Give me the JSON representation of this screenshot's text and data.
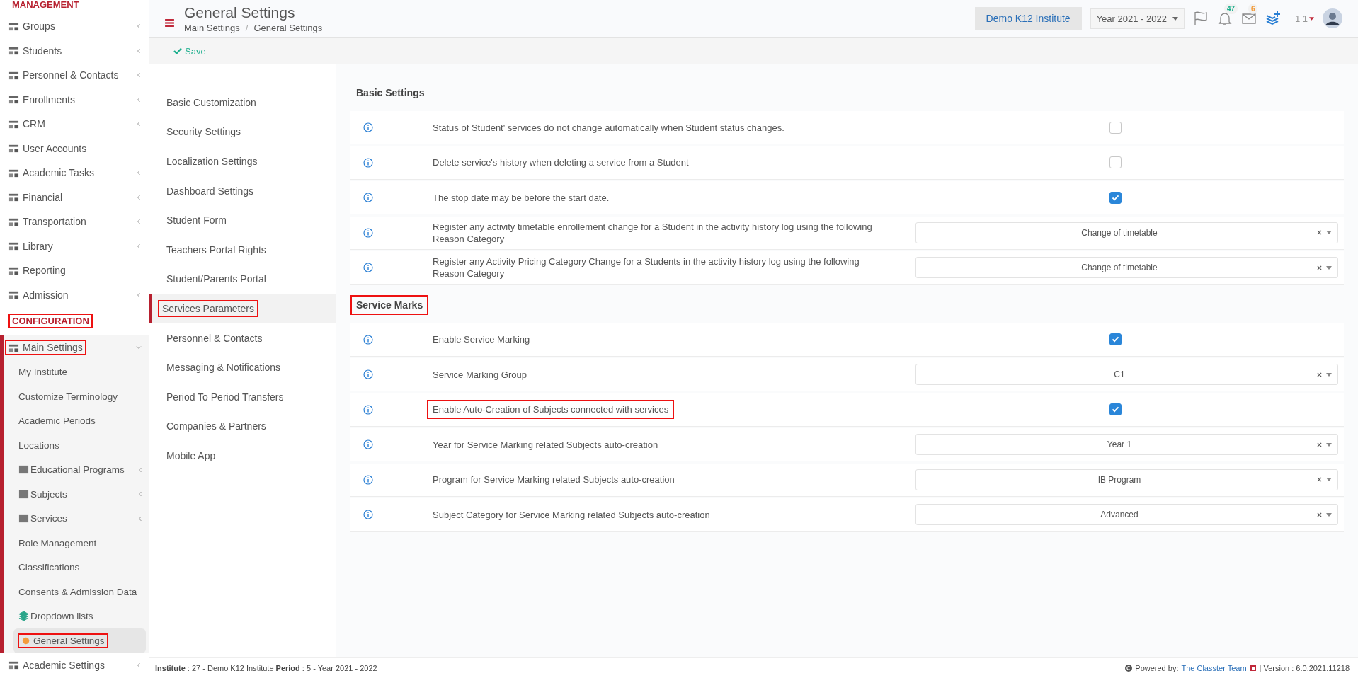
{
  "sidebar": {
    "sections": [
      {
        "title": "MANAGEMENT",
        "highlighted": false,
        "items": [
          {
            "label": "Groups",
            "has_children": true,
            "expanded": false,
            "highlighted": false
          },
          {
            "label": "Students",
            "has_children": true,
            "expanded": false,
            "highlighted": false
          },
          {
            "label": "Personnel & Contacts",
            "has_children": true,
            "expanded": false,
            "highlighted": false
          },
          {
            "label": "Enrollments",
            "has_children": true,
            "expanded": false,
            "highlighted": false
          },
          {
            "label": "CRM",
            "has_children": true,
            "expanded": false,
            "highlighted": false
          },
          {
            "label": "User Accounts",
            "has_children": false,
            "expanded": false,
            "highlighted": false
          },
          {
            "label": "Academic Tasks",
            "has_children": true,
            "expanded": false,
            "highlighted": false
          },
          {
            "label": "Financial",
            "has_children": true,
            "expanded": false,
            "highlighted": false
          },
          {
            "label": "Transportation",
            "has_children": true,
            "expanded": false,
            "highlighted": false
          },
          {
            "label": "Library",
            "has_children": true,
            "expanded": false,
            "highlighted": false
          },
          {
            "label": "Reporting",
            "has_children": false,
            "expanded": false,
            "highlighted": false
          },
          {
            "label": "Admission",
            "has_children": true,
            "expanded": false,
            "highlighted": false
          }
        ]
      },
      {
        "title": "CONFIGURATION",
        "highlighted": true,
        "items": [
          {
            "label": "Main Settings",
            "has_children": true,
            "expanded": true,
            "highlighted": true,
            "children": [
              {
                "label": "My Institute",
                "has_children": false,
                "selected": false,
                "highlighted": false
              },
              {
                "label": "Customize Terminology",
                "has_children": false,
                "selected": false,
                "highlighted": false
              },
              {
                "label": "Academic Periods",
                "has_children": false,
                "selected": false,
                "highlighted": false
              },
              {
                "label": "Locations",
                "has_children": false,
                "selected": false,
                "highlighted": false
              },
              {
                "label": "Educational Programs",
                "has_children": true,
                "selected": false,
                "highlighted": false
              },
              {
                "label": "Subjects",
                "has_children": true,
                "selected": false,
                "highlighted": false
              },
              {
                "label": "Services",
                "has_children": true,
                "selected": false,
                "highlighted": false
              },
              {
                "label": "Role Management",
                "has_children": false,
                "selected": false,
                "highlighted": false
              },
              {
                "label": "Classifications",
                "has_children": false,
                "selected": false,
                "highlighted": false
              },
              {
                "label": "Consents & Admission Data",
                "has_children": false,
                "selected": false,
                "highlighted": false
              },
              {
                "label": "Dropdown lists",
                "has_children": false,
                "selected": false,
                "highlighted": false
              },
              {
                "label": "General Settings",
                "has_children": false,
                "selected": true,
                "highlighted": true
              }
            ]
          },
          {
            "label": "Academic Settings",
            "has_children": true,
            "expanded": false,
            "highlighted": false
          }
        ]
      }
    ]
  },
  "header": {
    "title": "General Settings",
    "breadcrumbs": [
      "Main Settings",
      "General Settings"
    ],
    "breadcrumb_separator": "/",
    "institute": "Demo K12 Institute",
    "year": "Year 2021 - 2022",
    "notifications": "47",
    "messages": "6",
    "user": "1 1"
  },
  "toolbar": {
    "save": "Save"
  },
  "tabs": [
    {
      "label": "Basic Customization",
      "selected": false,
      "highlighted": false
    },
    {
      "label": "Security Settings",
      "selected": false,
      "highlighted": false
    },
    {
      "label": "Localization Settings",
      "selected": false,
      "highlighted": false
    },
    {
      "label": "Dashboard Settings",
      "selected": false,
      "highlighted": false
    },
    {
      "label": "Student Form",
      "selected": false,
      "highlighted": false
    },
    {
      "label": "Teachers Portal Rights",
      "selected": false,
      "highlighted": false
    },
    {
      "label": "Student/Parents Portal",
      "selected": false,
      "highlighted": false
    },
    {
      "label": "Services Parameters",
      "selected": true,
      "highlighted": true
    },
    {
      "label": "Personnel & Contacts",
      "selected": false,
      "highlighted": false
    },
    {
      "label": "Messaging & Notifications",
      "selected": false,
      "highlighted": false
    },
    {
      "label": "Period To Period Transfers",
      "selected": false,
      "highlighted": false
    },
    {
      "label": "Companies & Partners",
      "selected": false,
      "highlighted": false
    },
    {
      "label": "Mobile App",
      "selected": false,
      "highlighted": false
    }
  ],
  "groups": [
    {
      "title": "Basic Settings",
      "highlighted": false,
      "rows": [
        {
          "kind": "checkbox",
          "label": "Status of Student' services do not change automatically when Student status changes.",
          "checked": false,
          "highlighted": false
        },
        {
          "kind": "checkbox",
          "label": "Delete service's history when deleting a service from a Student",
          "checked": false,
          "highlighted": false
        },
        {
          "kind": "checkbox",
          "label": "The stop date may be before the start date.",
          "checked": true,
          "highlighted": false
        },
        {
          "kind": "select",
          "label": "Register any activity timetable enrollement change for a Student in the activity history log using the following Reason Category",
          "value": "Change of timetable",
          "highlighted": false
        },
        {
          "kind": "select",
          "label": "Register any Activity Pricing Category Change for a Students in the activity history log using the following Reason Category",
          "value": "Change of timetable",
          "highlighted": false
        }
      ]
    },
    {
      "title": "Service Marks",
      "highlighted": true,
      "rows": [
        {
          "kind": "checkbox",
          "label": "Enable Service Marking",
          "checked": true,
          "highlighted": false
        },
        {
          "kind": "select",
          "label": "Service Marking Group",
          "value": "C1",
          "highlighted": false
        },
        {
          "kind": "checkbox",
          "label": "Enable Auto-Creation of Subjects connected with services",
          "checked": true,
          "highlighted": true
        },
        {
          "kind": "select",
          "label": "Year for Service Marking related Subjects auto-creation",
          "value": "Year 1",
          "highlighted": false
        },
        {
          "kind": "select",
          "label": "Program for Service Marking related Subjects auto-creation",
          "value": "IB Program",
          "highlighted": false
        },
        {
          "kind": "select",
          "label": "Subject Category for Service Marking related Subjects auto-creation",
          "value": "Advanced",
          "highlighted": false
        }
      ]
    }
  ],
  "footer": {
    "info": "**Institute** : 27 - Demo K12 Institute **Period** : 5 - Year 2021 - 2022",
    "powered_by": "Powered by:",
    "team": "The Classter Team",
    "version": "| Version : 6.0.2021.11218"
  }
}
